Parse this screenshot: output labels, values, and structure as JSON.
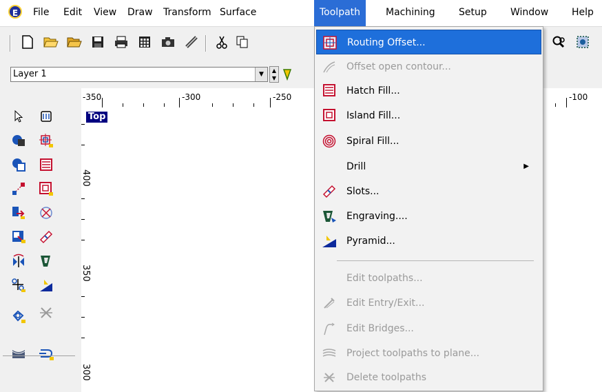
{
  "menubar": {
    "app_icon": "app-logo-icon",
    "items": [
      "File",
      "Edit",
      "View",
      "Draw",
      "Transform",
      "Surface",
      "Toolpath",
      "Machining",
      "Setup",
      "Window",
      "Help"
    ],
    "active": "Toolpath"
  },
  "toolbar": {
    "icons": [
      "new-file-icon",
      "open-file-icon",
      "open-folder-icon",
      "save-icon",
      "print-icon",
      "calculator-icon",
      "camera-icon",
      "ruler-icon",
      "cut-icon",
      "copy-icon",
      "zoom-icon",
      "select-region-icon"
    ]
  },
  "layerbar": {
    "layer_value": "Layer 1"
  },
  "rulers": {
    "horizontal": [
      "-350",
      "-300",
      "-250",
      "-100"
    ],
    "vertical": [
      "400",
      "350",
      "300"
    ]
  },
  "view": {
    "label": "Top"
  },
  "toolpath_menu": {
    "items": [
      {
        "label": "Routing Offset...",
        "icon": "routing-offset-icon",
        "state": "highlighted"
      },
      {
        "label": "Offset open contour...",
        "icon": "open-contour-icon",
        "state": "disabled"
      },
      {
        "label": "Hatch Fill...",
        "icon": "hatch-fill-icon",
        "state": "enabled"
      },
      {
        "label": "Island Fill...",
        "icon": "island-fill-icon",
        "state": "enabled"
      },
      {
        "label": "Spiral Fill...",
        "icon": "spiral-fill-icon",
        "state": "enabled"
      },
      {
        "label": "Drill",
        "icon": "",
        "state": "enabled",
        "submenu": true
      },
      {
        "label": "Slots...",
        "icon": "slots-icon",
        "state": "enabled"
      },
      {
        "label": "Engraving....",
        "icon": "engraving-icon",
        "state": "enabled"
      },
      {
        "label": "Pyramid...",
        "icon": "pyramid-icon",
        "state": "enabled"
      },
      {
        "label": "Edit toolpaths...",
        "icon": "",
        "state": "disabled"
      },
      {
        "label": "Edit Entry/Exit...",
        "icon": "edit-entry-exit-icon",
        "state": "disabled"
      },
      {
        "label": "Edit Bridges...",
        "icon": "edit-bridges-icon",
        "state": "disabled"
      },
      {
        "label": "Project toolpaths to plane...",
        "icon": "project-toolpaths-icon",
        "state": "disabled"
      },
      {
        "label": "Delete toolpaths",
        "icon": "delete-toolpaths-icon",
        "state": "disabled"
      }
    ]
  },
  "colors": {
    "highlight": "#1e6fdb",
    "active_menu": "#2b6dd6",
    "view_label_bg": "#000080",
    "disabled_text": "#9a9a9a"
  }
}
